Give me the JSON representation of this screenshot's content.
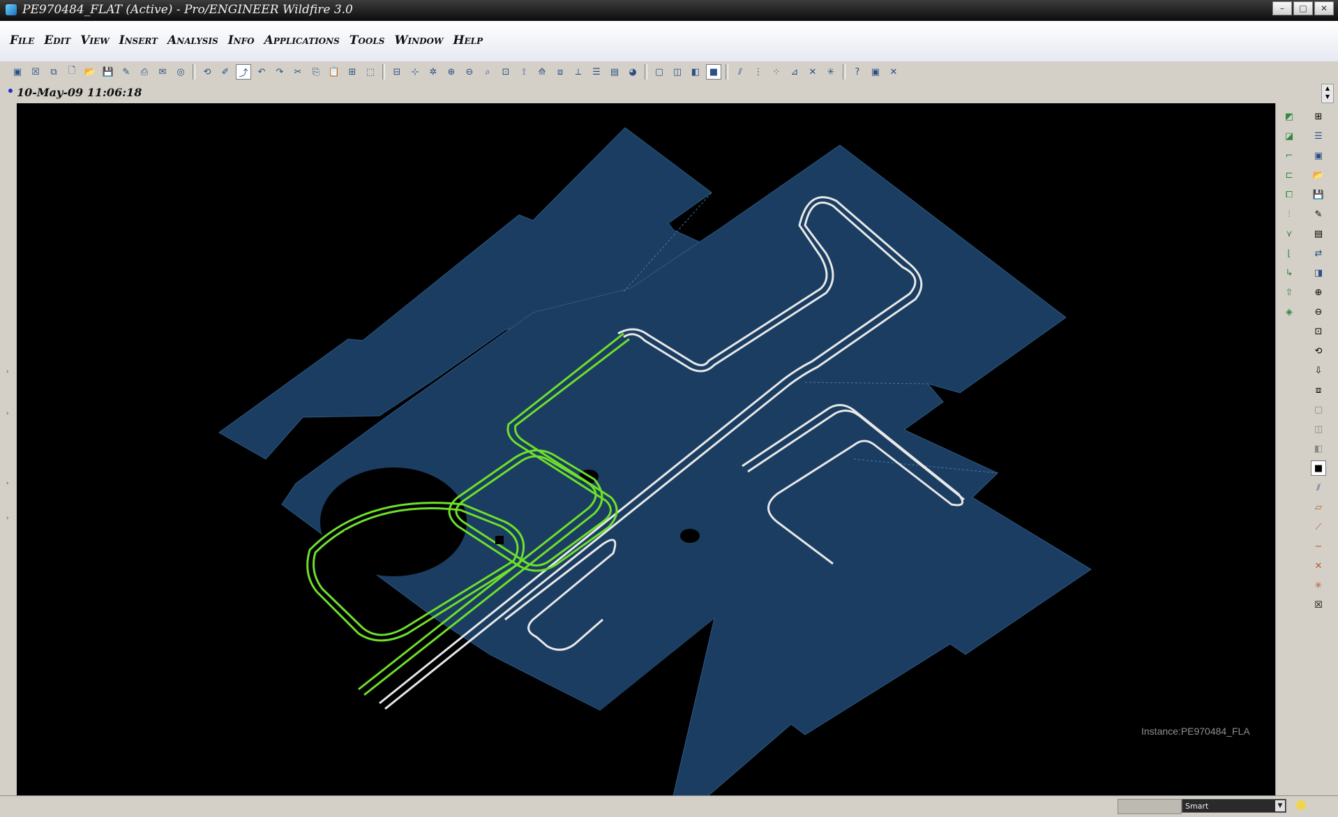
{
  "window": {
    "title": "PE970484_FLAT (Active) - Pro/ENGINEER Wildfire 3.0",
    "controls": [
      "–",
      "□",
      "✕"
    ]
  },
  "menu": [
    "File",
    "Edit",
    "View",
    "Insert",
    "Analysis",
    "Info",
    "Applications",
    "Tools",
    "Window",
    "Help"
  ],
  "message": {
    "text": "10-May-09 11:06:18"
  },
  "canvas": {
    "instance_label": "Instance:PE970484_FLA",
    "colors": {
      "background": "#000000",
      "sheet": "#1b3d61",
      "highlight": "#6ee02a",
      "trace": "#e8e8e8"
    }
  },
  "status": {
    "filter_value": "Smart"
  },
  "icons": {
    "toolbar": [
      "new-window-icon",
      "close-window-icon",
      "erase-icon",
      "new-file-icon",
      "open-icon",
      "save-icon",
      "print-icon",
      "sketch-icon"
    ],
    "right": [
      "datum-plane-icon",
      "datum-axis-icon",
      "datum-point-icon",
      "repaint-icon",
      "zoom-in-icon",
      "zoom-out-icon",
      "refit-icon",
      "shading-icon"
    ]
  }
}
